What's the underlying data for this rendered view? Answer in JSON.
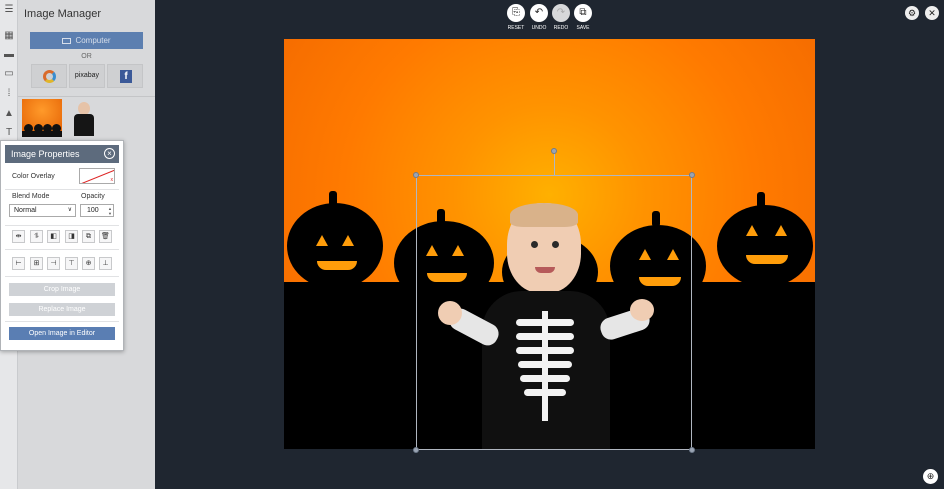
{
  "rail_icons": [
    "menu-icon",
    "grid-icon",
    "folder-icon",
    "image-icon",
    "apps-icon",
    "shape-icon",
    "text-icon"
  ],
  "manager": {
    "title": "Image Manager",
    "computer_label": "Computer",
    "or_label": "OR",
    "pixabay_label": "pixabay",
    "facebook_label": "f"
  },
  "properties": {
    "title": "Image Properties",
    "close_glyph": "×",
    "color_overlay_label": "Color Overlay",
    "blend_mode_label": "Blend Mode",
    "blend_mode_value": "Normal",
    "opacity_label": "Opacity",
    "opacity_value": "100",
    "crop_label": "Crop Image",
    "replace_label": "Replace Image",
    "open_editor_label": "Open Image in Editor"
  },
  "toolbar": {
    "reset_label": "RESET",
    "undo_label": "UNDO",
    "redo_label": "REDO",
    "save_label": "SAVE"
  },
  "colors": {
    "accent": "#5a7eb3",
    "panel_header": "#5d6b7d",
    "workspace": "#1f2630",
    "canvas_orange": "#ff8a00"
  }
}
